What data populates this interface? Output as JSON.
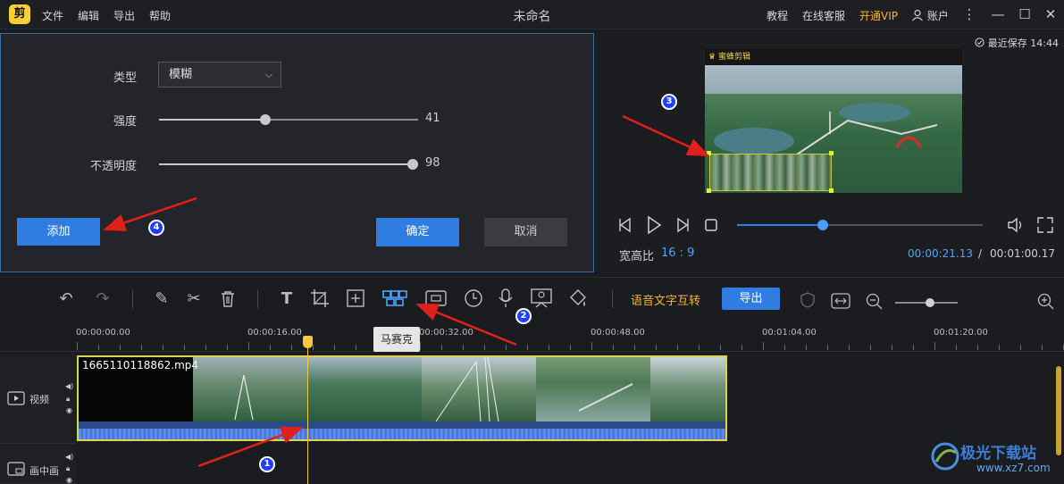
{
  "app": {
    "logo_text": "剪",
    "doc_title": "未命名",
    "menu": [
      "文件",
      "编辑",
      "导出",
      "帮助"
    ],
    "top_right": {
      "tutorial": "教程",
      "support": "在线客服",
      "vip": "开通VIP",
      "account": "账户"
    },
    "window_controls": [
      "menu-dots-icon",
      "minimize-icon",
      "maximize-icon",
      "close-icon"
    ]
  },
  "effect_panel": {
    "type_label": "类型",
    "type_value": "模糊",
    "strength_label": "强度",
    "strength_value": "41",
    "strength_level": 0.41,
    "opacity_label": "不透明度",
    "opacity_value": "98",
    "opacity_level": 0.98,
    "add_button": "添加",
    "confirm_button": "确定",
    "cancel_button": "取消"
  },
  "preview": {
    "last_save": "最近保存 14:44",
    "frame_header": "蜜蜂剪辑",
    "aspect_label": "宽高比",
    "aspect_value": "16 : 9",
    "current_time": "00:00:21.13",
    "time_separator": "/",
    "total_time": "00:01:00.17",
    "progress_fraction": 0.35
  },
  "toolbar": {
    "tooltip": "马赛克",
    "speech_to_text": "语音文字互转",
    "export": "导出",
    "tools": [
      "undo-icon",
      "redo-icon",
      "pen-icon",
      "scissors-icon",
      "delete-icon",
      "text-icon",
      "crop-icon",
      "zoom-frame-icon",
      "mosaic-icon",
      "freeze-frame-icon",
      "speed-icon",
      "mic-icon",
      "screen-record-icon",
      "paint-icon"
    ],
    "zoom_level": 0.55
  },
  "timeline": {
    "ticks": [
      "00:00:00.00",
      "00:00:16.00",
      "00:00:32.00",
      "00:00:48.00",
      "00:01:04.00",
      "00:01:20.00"
    ],
    "video_track_label": "视频",
    "pip_track_label": "画中画",
    "clip_name": "1665110118862.mp4"
  },
  "annotations": [
    "1",
    "2",
    "3",
    "4"
  ],
  "watermark": {
    "text": "极光下载站",
    "url": "www.xz7.com"
  },
  "colors": {
    "accent": "#2f7de1",
    "vip": "#f5b731",
    "playhead": "#f5c840",
    "annotation_arrow": "#e0201a"
  }
}
